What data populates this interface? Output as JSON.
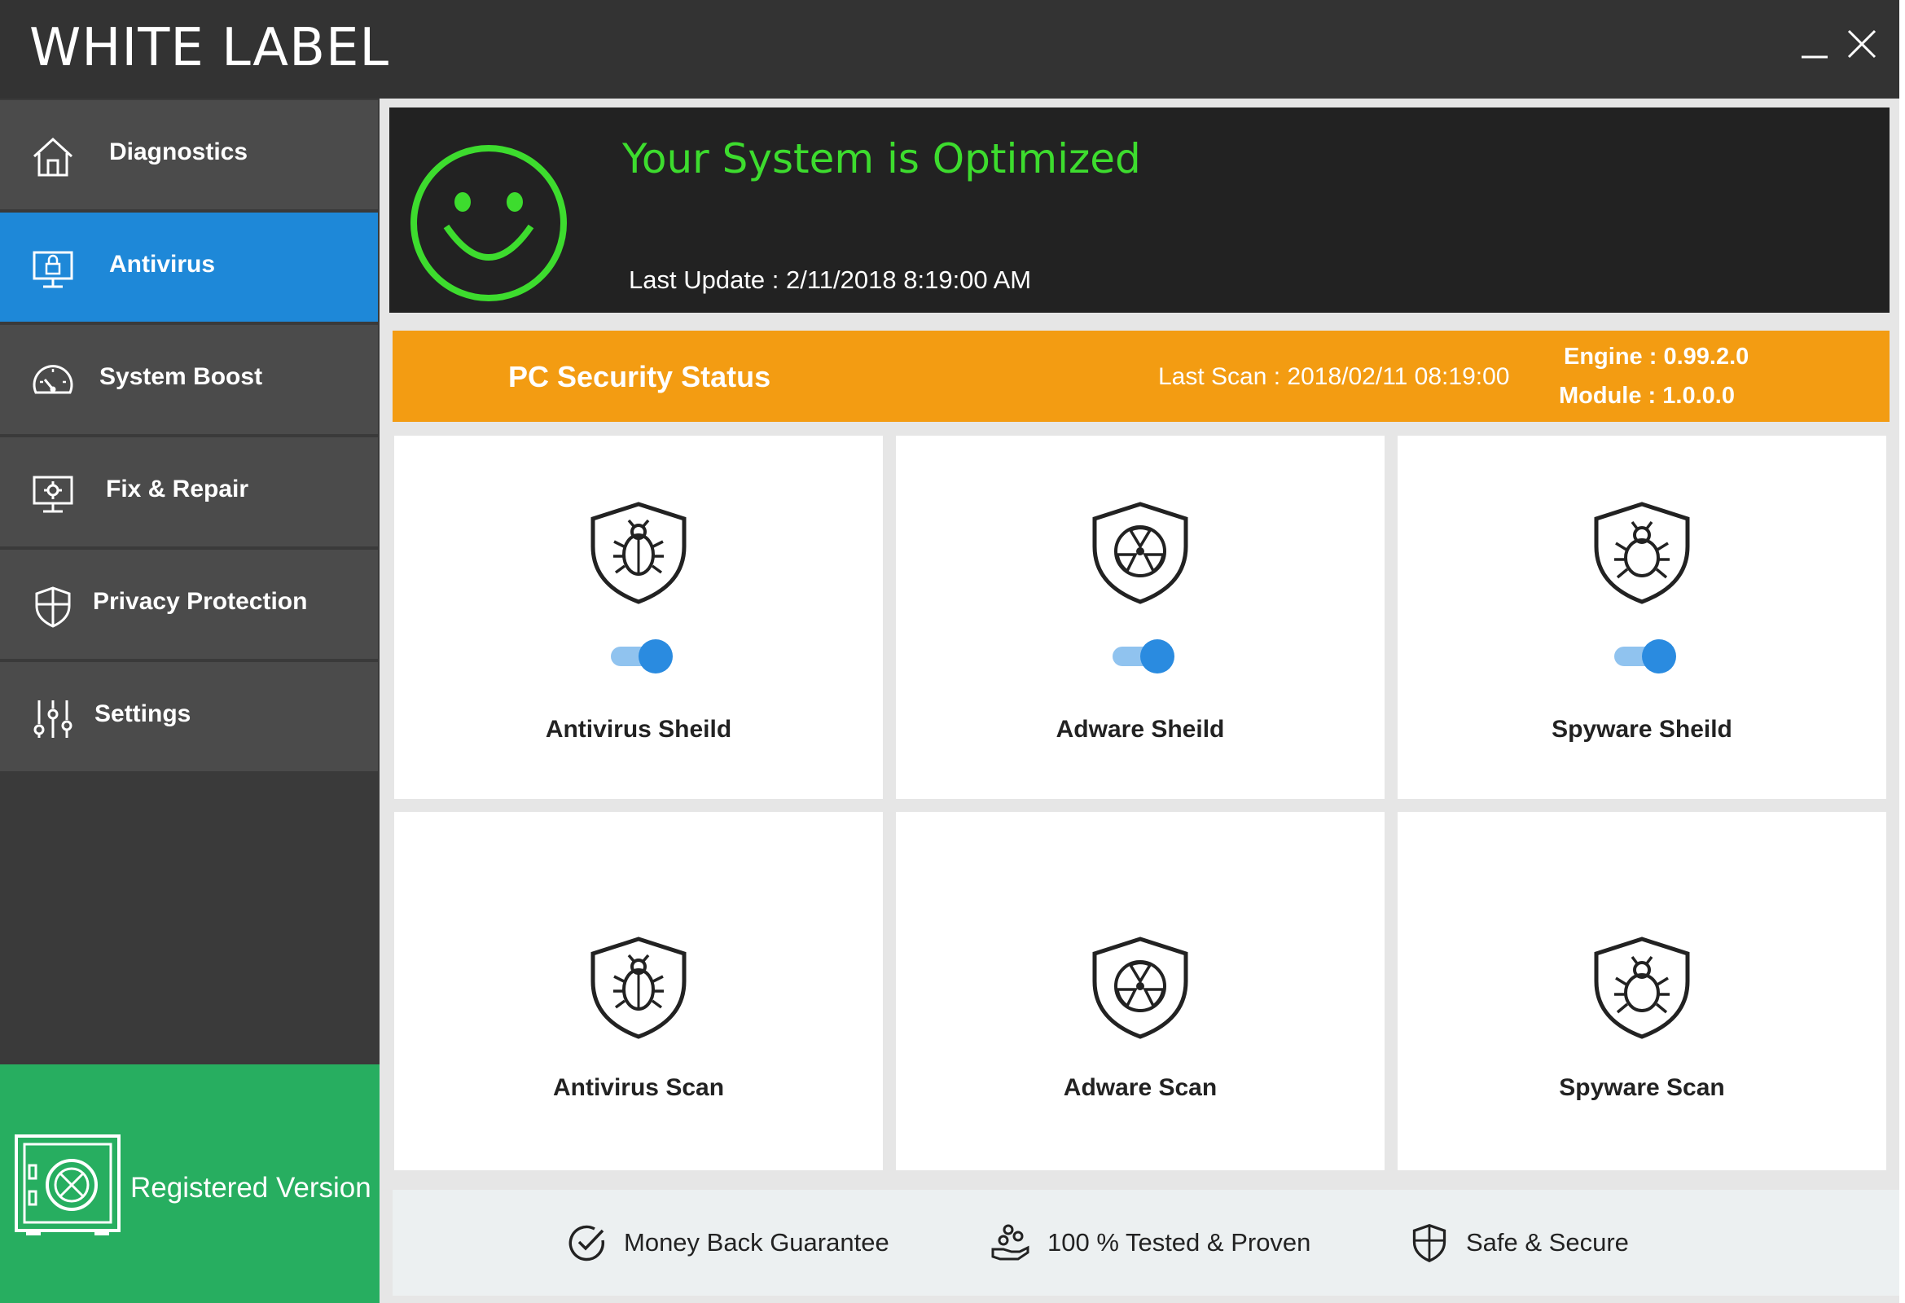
{
  "app": {
    "title": "WHITE LABEL"
  },
  "window_controls": {
    "minimize": "minimize-icon",
    "close": "close-icon"
  },
  "sidebar": {
    "items": [
      {
        "label": "Diagnostics",
        "icon": "home-icon",
        "active": false
      },
      {
        "label": "Antivirus",
        "icon": "monitor-lock-icon",
        "active": true
      },
      {
        "label": "System Boost",
        "icon": "speedometer-icon",
        "active": false
      },
      {
        "label": "Fix & Repair",
        "icon": "monitor-gear-icon",
        "active": false
      },
      {
        "label": "Privacy Protection",
        "icon": "shield-icon",
        "active": false
      },
      {
        "label": "Settings",
        "icon": "sliders-icon",
        "active": false
      }
    ],
    "registered": {
      "label": "Registered Version",
      "icon": "safe-icon"
    }
  },
  "status": {
    "title": "Your System is Optimized",
    "last_update": "Last Update : 2/11/2018 8:19:00 AM",
    "icon": "smiley-icon"
  },
  "security_bar": {
    "title": "PC Security Status",
    "last_scan": "Last Scan : 2018/02/11 08:19:00",
    "engine": "Engine : 0.99.2.0",
    "module": "Module : 1.0.0.0"
  },
  "shields": [
    {
      "label": "Antivirus Sheild",
      "icon": "bug-shield-icon",
      "enabled": true
    },
    {
      "label": "Adware Sheild",
      "icon": "radiation-shield-icon",
      "enabled": true
    },
    {
      "label": "Spyware Sheild",
      "icon": "spider-shield-icon",
      "enabled": true
    }
  ],
  "scans": [
    {
      "label": "Antivirus Scan",
      "icon": "bug-shield-icon"
    },
    {
      "label": "Adware Scan",
      "icon": "radiation-shield-icon"
    },
    {
      "label": "Spyware Scan",
      "icon": "spider-shield-icon"
    }
  ],
  "features": [
    {
      "label": "Money Back Guarantee",
      "icon": "check-circle-icon"
    },
    {
      "label": "100 % Tested & Proven",
      "icon": "hand-coins-icon"
    },
    {
      "label": "Safe & Secure",
      "icon": "shield-icon"
    }
  ],
  "colors": {
    "titlebar": "#333333",
    "sidebar_item": "#4b4b4b",
    "active_item": "#1e88d8",
    "registered": "#27ae60",
    "status_bg": "#222222",
    "status_text": "#3ddc2e",
    "security_bar": "#f39c12",
    "toggle": "#2a8be0"
  }
}
